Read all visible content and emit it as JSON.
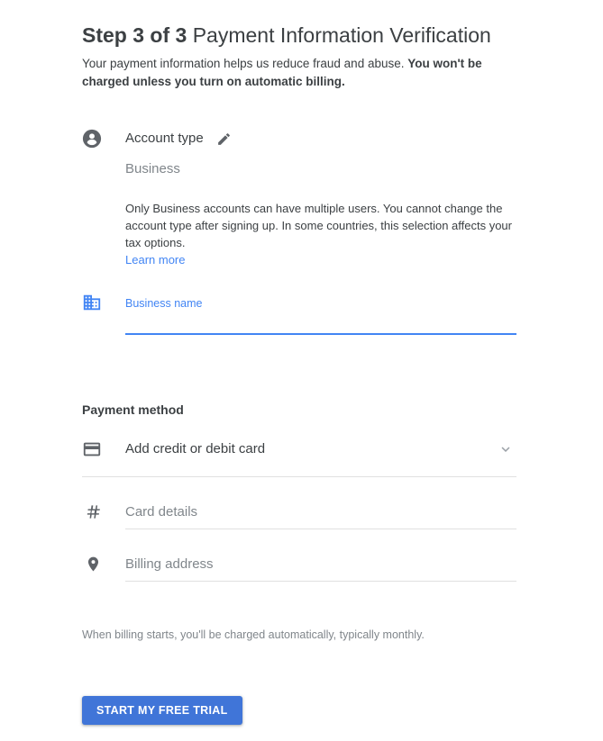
{
  "header": {
    "step_label": "Step 3 of 3",
    "title_rest": " Payment Information Verification",
    "subtitle_normal": "Your payment information helps us reduce fraud and abuse. ",
    "subtitle_bold": "You won't be charged unless you turn on automatic billing."
  },
  "account_type": {
    "person_icon": "account-circle-icon",
    "edit_icon": "pencil-edit-icon",
    "label": "Account type",
    "value": "Business",
    "description": "Only Business accounts can have multiple users. You cannot change the account type after signing up. In some countries, this selection affects your tax options.",
    "learn_more": "Learn more"
  },
  "business_name": {
    "icon": "business-building-icon",
    "label": "Business name",
    "value": "",
    "placeholder": "",
    "focused": true,
    "accent_color": "#4285f4"
  },
  "payment_method": {
    "section_title": "Payment method",
    "card_icon": "credit-card-icon",
    "selected_option": "Add credit or debit card",
    "chevron_icon": "chevron-down-icon",
    "options": [
      "Add credit or debit card"
    ],
    "fields": [
      {
        "name": "card-details",
        "icon": "hash-number-icon",
        "placeholder": "Card details",
        "value": ""
      },
      {
        "name": "billing-address",
        "icon": "location-pin-icon",
        "placeholder": "Billing address",
        "value": ""
      }
    ]
  },
  "footer": {
    "note": "When billing starts, you'll be charged automatically, typically monthly.",
    "cta_label": "START MY FREE TRIAL",
    "cta_color": "#4075d8"
  }
}
